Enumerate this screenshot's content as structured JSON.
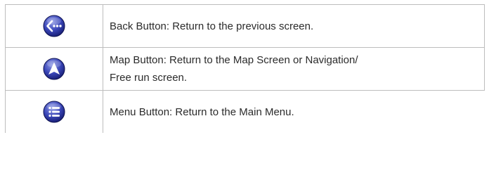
{
  "colors": {
    "border": "#bdbdbd",
    "icon_dark": "#141a6e",
    "icon_mid": "#3a46b8",
    "icon_light": "#8f9ae6",
    "text": "#2b2b2b"
  },
  "rows": [
    {
      "icon": "back-icon",
      "text": "Back Button: Return to the previous screen."
    },
    {
      "icon": "map-arrow-icon",
      "text_line1": "Map Button: Return to the Map Screen or Navigation/",
      "text_line2": "Free run screen."
    },
    {
      "icon": "menu-list-icon",
      "text": "Menu Button: Return to the Main Menu."
    }
  ]
}
